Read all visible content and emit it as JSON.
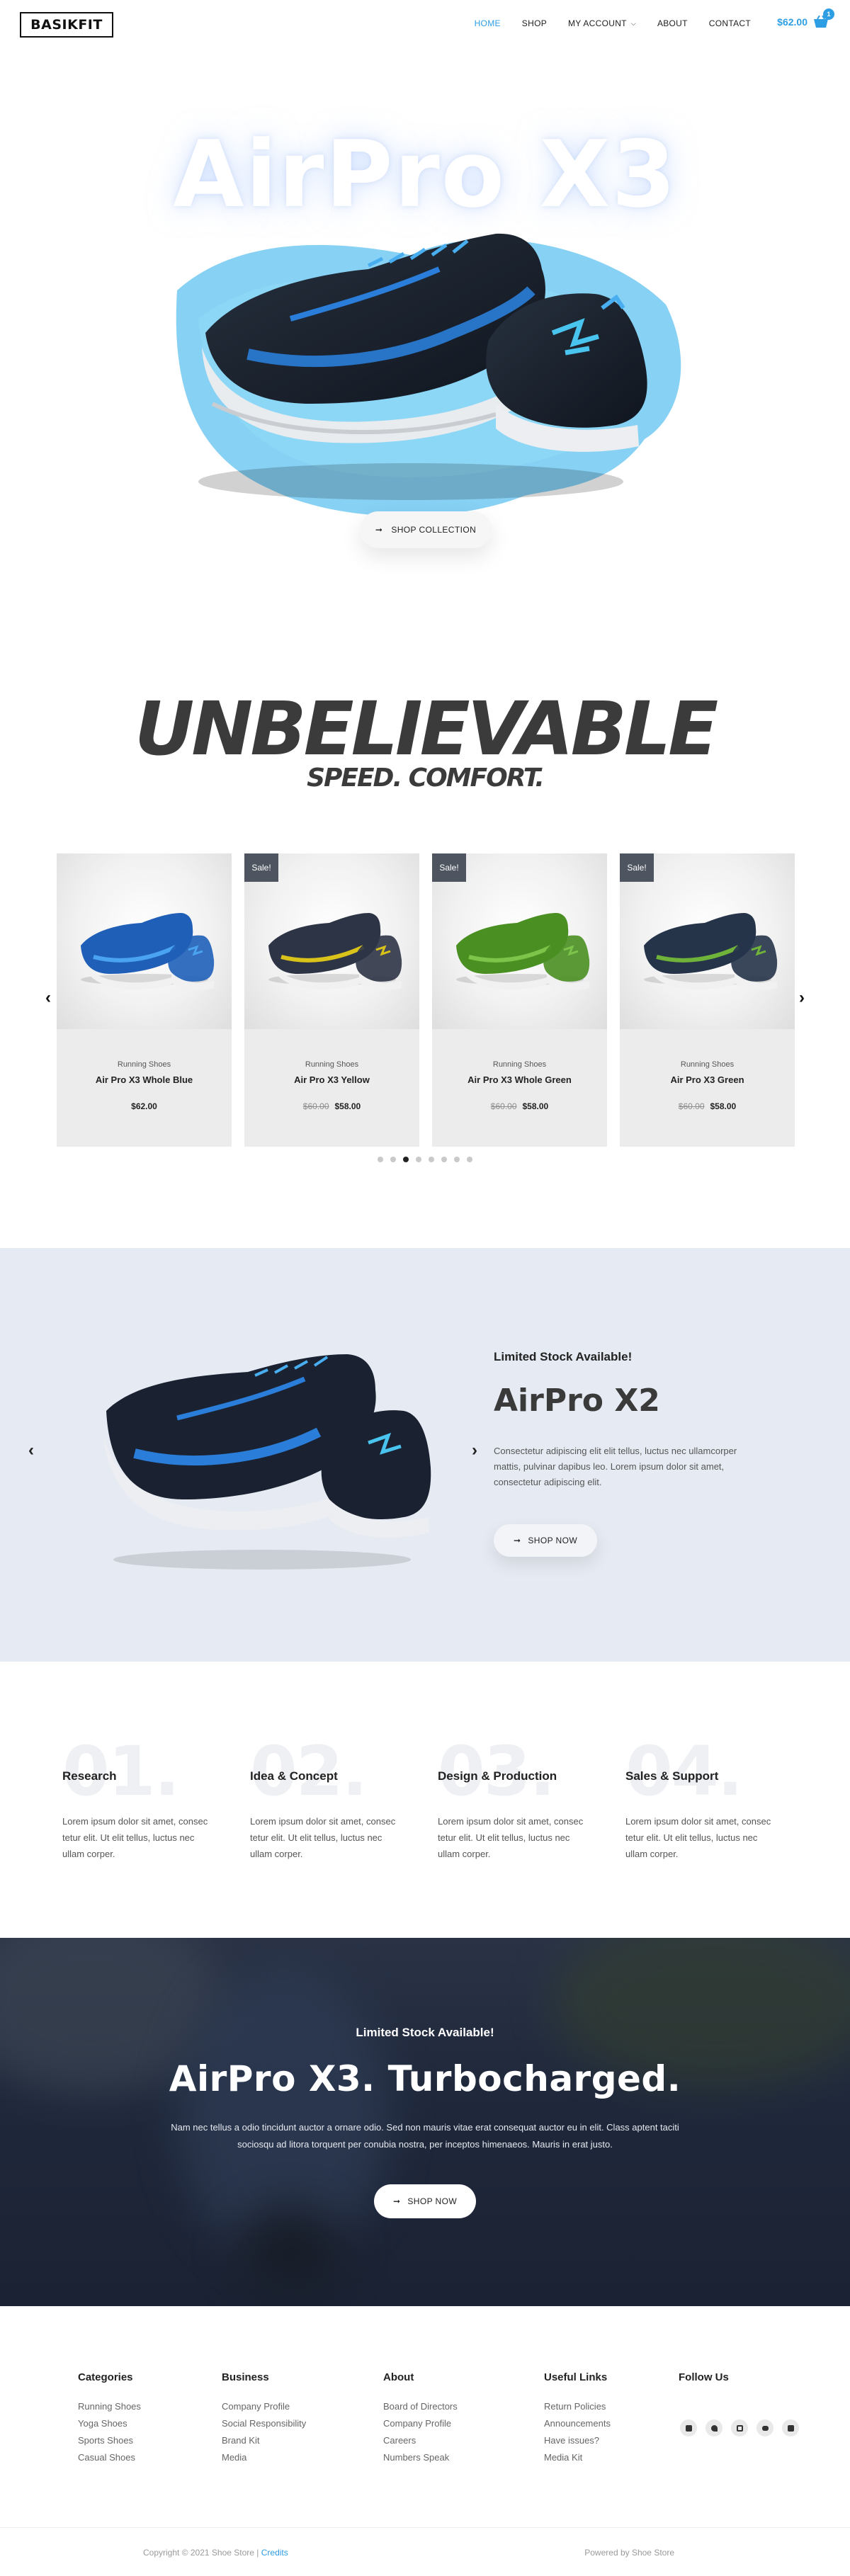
{
  "header": {
    "logo": "BASIKFIT",
    "nav": [
      {
        "label": "HOME",
        "active": true
      },
      {
        "label": "SHOP",
        "active": false
      },
      {
        "label": "MY ACCOUNT",
        "active": false,
        "dropdown": true
      },
      {
        "label": "ABOUT",
        "active": false
      },
      {
        "label": "CONTACT",
        "active": false
      }
    ],
    "cart_total": "$62.00",
    "cart_count": "1",
    "accent": "#2e9ee4"
  },
  "hero": {
    "title": "AirPro X3",
    "button_label": "SHOP COLLECTION",
    "button_icon": "arrow-right-icon"
  },
  "tagline": {
    "headline": "UNBELIEVABLE",
    "subline": "SPEED. COMFORT."
  },
  "products": [
    {
      "sale": "",
      "category": "Running Shoes",
      "name": "Air Pro X3 Whole Blue",
      "old_price": "",
      "price": "$62.00",
      "color": "#1f5fb8",
      "accent": "#4aa3f0"
    },
    {
      "sale": "Sale!",
      "category": "Running Shoes",
      "name": "Air Pro X3 Yellow",
      "old_price": "$60.00",
      "price": "$58.00",
      "color": "#2d3446",
      "accent": "#d9c21a"
    },
    {
      "sale": "Sale!",
      "category": "Running Shoes",
      "name": "Air Pro X3 Whole Green",
      "old_price": "$60.00",
      "price": "$58.00",
      "color": "#4a8f22",
      "accent": "#7cc44a"
    },
    {
      "sale": "Sale!",
      "category": "Running Shoes",
      "name": "Air Pro X3 Green",
      "old_price": "$60.00",
      "price": "$58.00",
      "color": "#26344a",
      "accent": "#6fb33a"
    }
  ],
  "carousel_dots": {
    "count": 8,
    "active": 2
  },
  "feature": {
    "kicker": "Limited Stock Available!",
    "title": "AirPro X2",
    "text": "Consectetur adipiscing elit elit tellus, luctus nec ullamcorper mattis, pulvinar dapibus leo. Lorem ipsum dolor sit amet, consectetur adipiscing elit.",
    "button_label": "SHOP NOW",
    "background": "#e6ebf3"
  },
  "steps": [
    {
      "number": "01.",
      "title": "Research",
      "text": "Lorem ipsum dolor sit amet, consec tetur elit. Ut elit tellus, luctus nec ullam corper."
    },
    {
      "number": "02.",
      "title": "Idea & Concept",
      "text": "Lorem ipsum dolor sit amet, consec tetur elit. Ut elit tellus, luctus nec ullam corper."
    },
    {
      "number": "03.",
      "title": "Design & Production",
      "text": "Lorem ipsum dolor sit amet, consec tetur elit. Ut elit tellus, luctus nec ullam corper."
    },
    {
      "number": "04.",
      "title": "Sales & Support",
      "text": "Lorem ipsum dolor sit amet, consec tetur elit. Ut elit tellus, luctus nec ullam corper."
    }
  ],
  "banner": {
    "kicker": "Limited Stock Available!",
    "title": "AirPro X3. Turbocharged.",
    "text": "Nam nec tellus a odio tincidunt auctor a ornare odio. Sed non mauris vitae erat consequat auctor eu in elit. Class aptent taciti sociosqu ad litora torquent per conubia nostra, per inceptos himenaeos. Mauris in erat justo.",
    "button_label": "SHOP NOW"
  },
  "footer": {
    "categories": {
      "title": "Categories",
      "items": [
        "Running Shoes",
        "Yoga Shoes",
        "Sports Shoes",
        "Casual Shoes"
      ]
    },
    "business": {
      "title": "Business",
      "items": [
        "Company Profile",
        "Social Responsibility",
        "Brand Kit",
        "Media"
      ]
    },
    "about": {
      "title": "About",
      "items": [
        "Board of Directors",
        "Company Profile",
        "Careers",
        "Numbers Speak"
      ]
    },
    "useful": {
      "title": "Useful Links",
      "items": [
        "Return Policies",
        "Announcements",
        "Have issues?",
        "Media Kit"
      ]
    },
    "follow": {
      "title": "Follow Us",
      "icons": [
        "facebook-icon",
        "twitter-icon",
        "instagram-icon",
        "youtube-icon",
        "linkedin-icon"
      ]
    },
    "copyright": "Copyright © 2021 Shoe Store | ",
    "credits": "Credits",
    "powered": "Powered by Shoe Store"
  }
}
